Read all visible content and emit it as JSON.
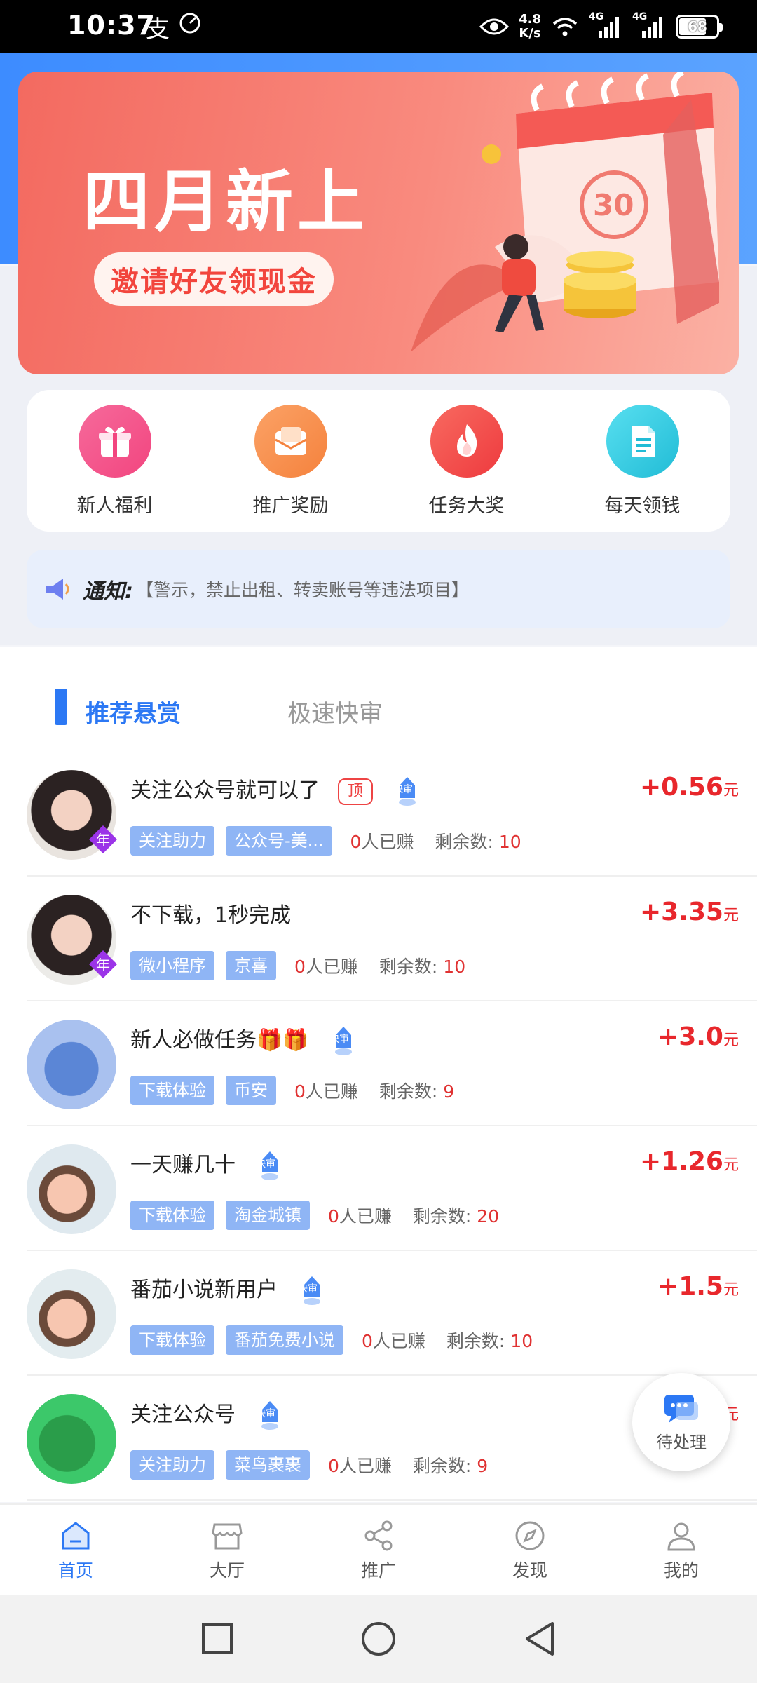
{
  "status_bar": {
    "time": "10:37",
    "speed_value": "4.8",
    "speed_unit": "K/s",
    "net1": "4G",
    "net2": "4G",
    "battery": "68"
  },
  "banner": {
    "title": "四月新上",
    "button": "邀请好友领现金",
    "calendar_day": "30"
  },
  "quick_menu": [
    {
      "label": "新人福利",
      "icon": "gift-icon",
      "color": "#f3508b"
    },
    {
      "label": "推广奖励",
      "icon": "envelope-icon",
      "color": "#f78d47"
    },
    {
      "label": "任务大奖",
      "icon": "flame-icon",
      "color": "#f24d4d"
    },
    {
      "label": "每天领钱",
      "icon": "document-icon",
      "color": "#28c6d8"
    }
  ],
  "notice": {
    "title": "通知:",
    "text": "【警示，禁止出租、转卖账号等违法项目】"
  },
  "tabs": {
    "active": "推荐悬赏",
    "inactive": "极速快审"
  },
  "badges": {
    "year": "年",
    "top": "顶",
    "fast": "快审"
  },
  "tasks": [
    {
      "title": "关注公众号就可以了",
      "has_top": true,
      "has_fast": true,
      "year_badge": true,
      "tags": [
        "关注助力",
        "公众号-美..."
      ],
      "earned_count": "0",
      "earned_suffix": "人已赚",
      "remain_label": "剩余数: ",
      "remain": "10",
      "reward": "+0.56",
      "unit": "元"
    },
    {
      "title": "不下载，1秒完成",
      "has_top": false,
      "has_fast": false,
      "year_badge": true,
      "tags": [
        "微小程序",
        "京喜"
      ],
      "earned_count": "0",
      "earned_suffix": "人已赚",
      "remain_label": "剩余数: ",
      "remain": "10",
      "reward": "+3.35",
      "unit": "元"
    },
    {
      "title": "新人必做任务🎁🎁",
      "has_top": false,
      "has_fast": true,
      "year_badge": false,
      "tags": [
        "下载体验",
        "币安"
      ],
      "earned_count": "0",
      "earned_suffix": "人已赚",
      "remain_label": "剩余数: ",
      "remain": "9",
      "reward": "+3.0",
      "unit": "元"
    },
    {
      "title": "一天赚几十",
      "has_top": false,
      "has_fast": true,
      "year_badge": false,
      "tags": [
        "下载体验",
        "淘金城镇"
      ],
      "earned_count": "0",
      "earned_suffix": "人已赚",
      "remain_label": "剩余数: ",
      "remain": "20",
      "reward": "+1.26",
      "unit": "元"
    },
    {
      "title": "番茄小说新用户",
      "has_top": false,
      "has_fast": true,
      "year_badge": false,
      "tags": [
        "下载体验",
        "番茄免费小说"
      ],
      "earned_count": "0",
      "earned_suffix": "人已赚",
      "remain_label": "剩余数: ",
      "remain": "10",
      "reward": "+1.5",
      "unit": "元"
    },
    {
      "title": "关注公众号",
      "has_top": false,
      "has_fast": true,
      "year_badge": false,
      "tags": [
        "关注助力",
        "菜鸟裹裹"
      ],
      "earned_count": "0",
      "earned_suffix": "人已赚",
      "remain_label": "剩余数: ",
      "remain": "9",
      "reward": "",
      "unit": "元"
    }
  ],
  "pending": {
    "label": "待处理"
  },
  "bottom_nav": [
    {
      "label": "首页",
      "icon": "home-icon",
      "active": true
    },
    {
      "label": "大厅",
      "icon": "store-icon",
      "active": false
    },
    {
      "label": "推广",
      "icon": "share-icon",
      "active": false
    },
    {
      "label": "发现",
      "icon": "compass-icon",
      "active": false
    },
    {
      "label": "我的",
      "icon": "user-icon",
      "active": false
    }
  ],
  "colors": {
    "primary": "#2c78f4",
    "reward": "#e8272c",
    "banner": "#f36a60"
  }
}
